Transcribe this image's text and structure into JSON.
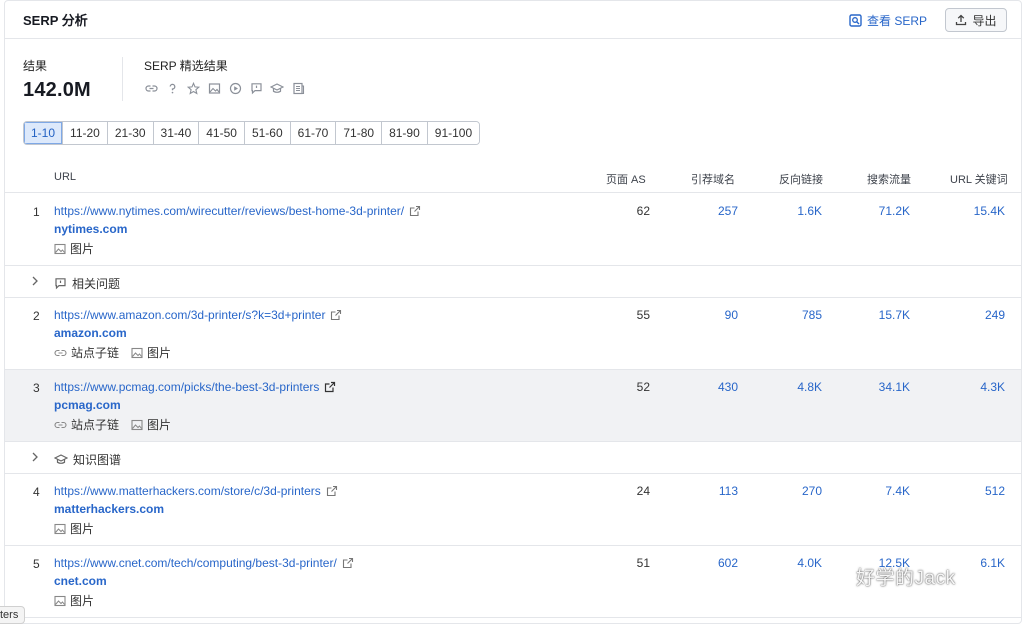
{
  "header": {
    "title": "SERP 分析",
    "view_serp_label": "查看 SERP",
    "export_label": "导出"
  },
  "summary": {
    "results_label": "结果",
    "results_value": "142.0M",
    "features_label": "SERP 精选结果",
    "feature_icons": [
      "link-icon",
      "question-icon",
      "star-icon",
      "image-icon",
      "video-icon",
      "comment-icon",
      "graduation-cap-icon",
      "news-icon"
    ]
  },
  "pagination": [
    "1-10",
    "11-20",
    "21-30",
    "31-40",
    "41-50",
    "51-60",
    "61-70",
    "71-80",
    "81-90",
    "91-100"
  ],
  "pagination_active": "1-10",
  "table": {
    "columns": [
      "URL",
      "页面 AS",
      "引荐域名",
      "反向链接",
      "搜索流量",
      "URL 关键词"
    ],
    "rows": [
      {
        "num": "1",
        "url": "https://www.nytimes.com/wirecutter/reviews/best-home-3d-printer/",
        "domain": "nytimes.com",
        "tags": [
          "图片"
        ],
        "as": "62",
        "ref_domains": "257",
        "backlinks": "1.6K",
        "traffic": "71.2K",
        "keywords": "15.4K"
      },
      {
        "num": "2",
        "url": "https://www.amazon.com/3d-printer/s?k=3d+printer",
        "domain": "amazon.com",
        "tags": [
          "站点子链",
          "图片"
        ],
        "as": "55",
        "ref_domains": "90",
        "backlinks": "785",
        "traffic": "15.7K",
        "keywords": "249"
      },
      {
        "num": "3",
        "url": "https://www.pcmag.com/picks/the-best-3d-printers",
        "domain": "pcmag.com",
        "tags": [
          "站点子链",
          "图片"
        ],
        "as": "52",
        "ref_domains": "430",
        "backlinks": "4.8K",
        "traffic": "34.1K",
        "keywords": "4.3K"
      },
      {
        "num": "4",
        "url": "https://www.matterhackers.com/store/c/3d-printers",
        "domain": "matterhackers.com",
        "tags": [
          "图片"
        ],
        "as": "24",
        "ref_domains": "113",
        "backlinks": "270",
        "traffic": "7.4K",
        "keywords": "512"
      },
      {
        "num": "5",
        "url": "https://www.cnet.com/tech/computing/best-3d-printer/",
        "domain": "cnet.com",
        "tags": [
          "图片"
        ],
        "as": "51",
        "ref_domains": "602",
        "backlinks": "4.0K",
        "traffic": "12.5K",
        "keywords": "6.1K"
      }
    ],
    "groups": [
      {
        "label": "相关问题",
        "icon": "comment-icon"
      },
      {
        "label": "知识图谱",
        "icon": "graduation-cap-icon"
      }
    ]
  },
  "tooltip_text": "ters",
  "watermark_text": "好学的Jack",
  "colors": {
    "link": "#2866c9",
    "active_page_bg": "#dde9fb",
    "highlight_row": "#f1f2f4",
    "border": "#e4e6ea"
  }
}
